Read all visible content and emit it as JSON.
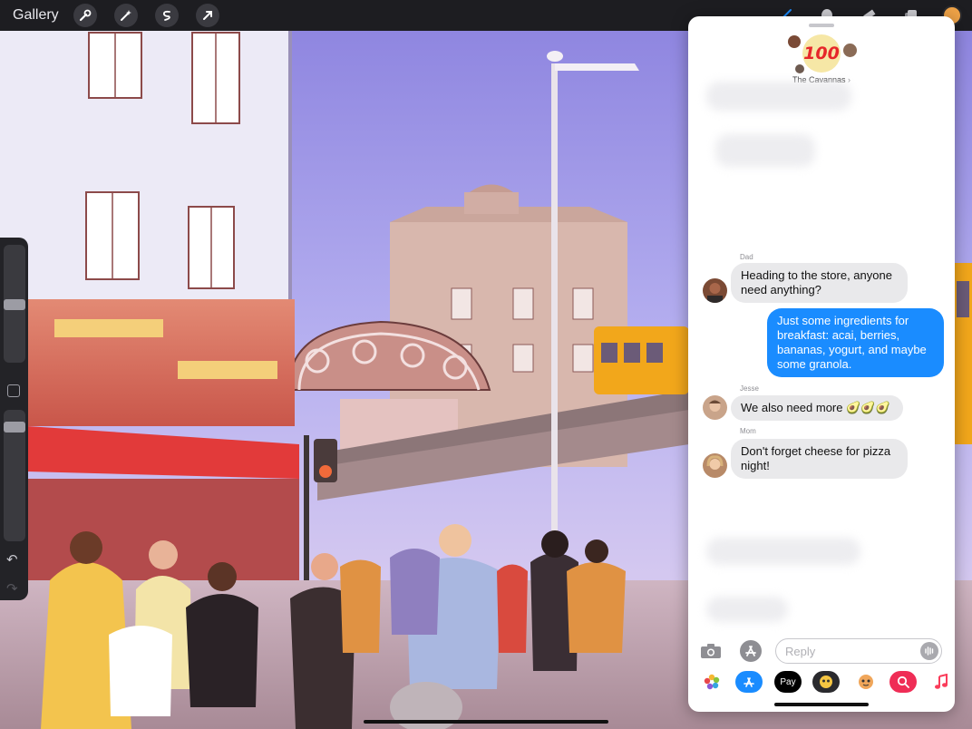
{
  "app": {
    "gallery_label": "Gallery",
    "toolbar_left_icons": [
      "wrench-icon",
      "magic-wand-icon",
      "selection-icon",
      "transform-arrow-icon"
    ],
    "toolbar_right_icons": [
      "brush-icon",
      "smudge-icon",
      "eraser-icon",
      "layers-icon",
      "color-swatch"
    ],
    "current_color": "#f0a347",
    "sidebar": {
      "undo_icon": "undo-icon",
      "redo_icon": "redo-icon"
    }
  },
  "messages": {
    "conversation_name": "The Cavannas",
    "conversation_chevron": "›",
    "group_emoji": "100",
    "thread": [
      {
        "sender": "Dad",
        "direction": "in",
        "text": "Heading to the store, anyone need anything?"
      },
      {
        "sender": "",
        "direction": "out",
        "text": "Just some ingredients for breakfast: acai, berries, bananas, yogurt, and maybe some granola."
      },
      {
        "sender": "Jesse",
        "direction": "in",
        "text": "We also need more 🥑🥑🥑"
      },
      {
        "sender": "Mom",
        "direction": "in",
        "text": "Don't forget cheese for pizza night!"
      }
    ],
    "reply_placeholder": "Reply",
    "apple_pay_label": "Pay",
    "input_icons": [
      "camera-icon",
      "app-store-icon",
      "audio-waveform-icon"
    ],
    "app_drawer": [
      "photos-app-icon",
      "app-store-app-icon",
      "apple-pay-app-icon",
      "memoji-app-icon",
      "animoji-app-icon",
      "image-search-app-icon",
      "music-app-icon"
    ],
    "accent_color": "#1a8cff"
  }
}
